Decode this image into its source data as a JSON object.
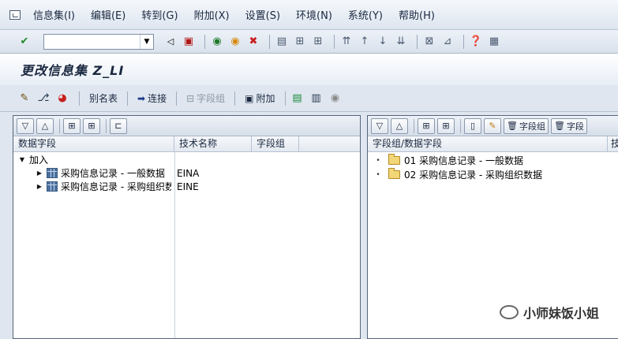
{
  "menu": {
    "items": [
      "信息集(I)",
      "编辑(E)",
      "转到(G)",
      "附加(X)",
      "设置(S)",
      "环境(N)",
      "系统(Y)",
      "帮助(H)"
    ]
  },
  "std_toolbar": {
    "command_value": ""
  },
  "title": "更改信息集 Z_LI",
  "app_toolbar": {
    "alias_label": "别名表",
    "join_label": "连接",
    "field_group_label": "字段组",
    "extras_label": "附加"
  },
  "left_panel": {
    "columns": [
      "数据字段",
      "技术名称",
      "字段组"
    ],
    "root_label": "加入",
    "rows": [
      {
        "label": "采购信息记录 - 一般数据",
        "tech": "EINA"
      },
      {
        "label": "采购信息记录 - 采购组织数据",
        "tech": "EINE"
      }
    ]
  },
  "right_panel": {
    "buttons": {
      "field_group": "字段组",
      "field": "字段"
    },
    "columns": [
      "字段组/数据字段",
      "技"
    ],
    "rows": [
      {
        "label": "01 采购信息记录 - 一般数据"
      },
      {
        "label": "02 采购信息记录 - 采购组织数据"
      }
    ]
  },
  "watermark": "小师妹饭小姐",
  "colors": {
    "title": "#1a2840",
    "panel_border": "#56657c",
    "background": "#dfe6ef"
  }
}
